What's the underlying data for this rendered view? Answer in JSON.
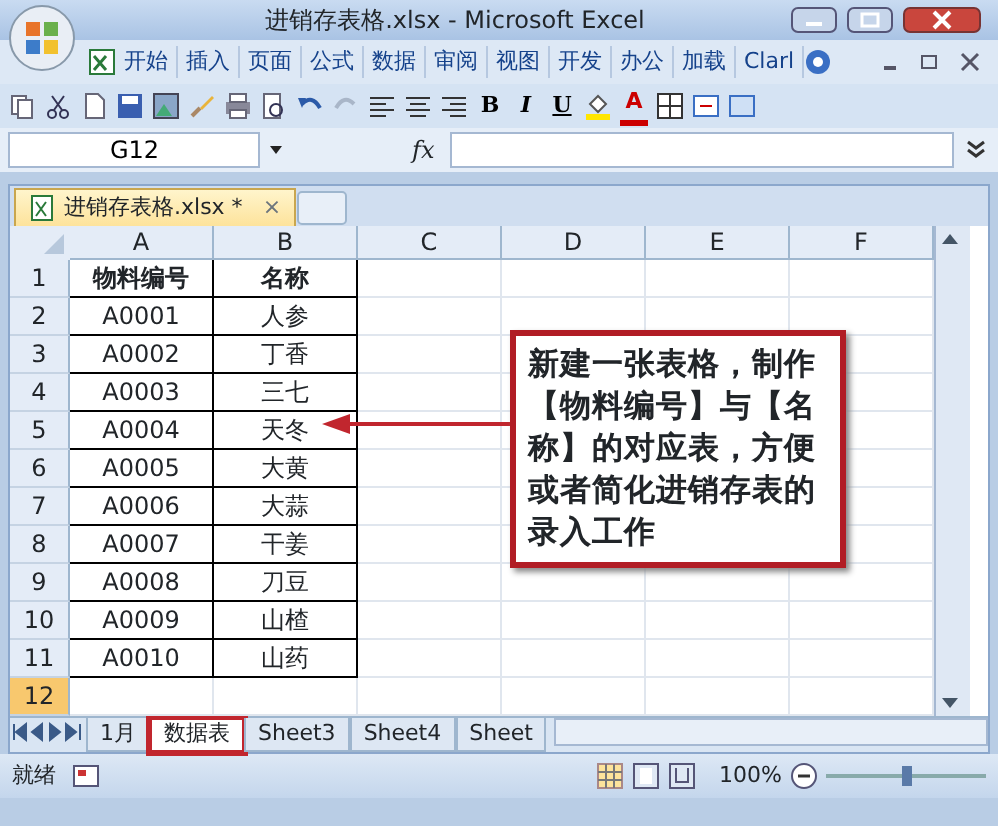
{
  "window": {
    "title": "进销存表格.xlsx - Microsoft Excel"
  },
  "ribbon_tabs": [
    "开始",
    "插入",
    "页面",
    "公式",
    "数据",
    "审阅",
    "视图",
    "开发",
    "办公",
    "加载",
    "Clarl"
  ],
  "format_buttons": [
    "B",
    "I",
    "U",
    "A"
  ],
  "name_box": {
    "value": "G12"
  },
  "formula_bar": {
    "label": "fx"
  },
  "workbook_tab": {
    "label": "进销存表格.xlsx *",
    "close": "×"
  },
  "columns": [
    "A",
    "B",
    "C",
    "D",
    "E",
    "F"
  ],
  "rows": [
    {
      "number": "1",
      "selected": false,
      "cells": [
        "物料编号",
        "名称"
      ]
    },
    {
      "number": "2",
      "selected": false,
      "cells": [
        "A0001",
        "人参"
      ]
    },
    {
      "number": "3",
      "selected": false,
      "cells": [
        "A0002",
        "丁香"
      ]
    },
    {
      "number": "4",
      "selected": false,
      "cells": [
        "A0003",
        "三七"
      ]
    },
    {
      "number": "5",
      "selected": false,
      "cells": [
        "A0004",
        "天冬"
      ]
    },
    {
      "number": "6",
      "selected": false,
      "cells": [
        "A0005",
        "大黄"
      ]
    },
    {
      "number": "7",
      "selected": false,
      "cells": [
        "A0006",
        "大蒜"
      ]
    },
    {
      "number": "8",
      "selected": false,
      "cells": [
        "A0007",
        "干姜"
      ]
    },
    {
      "number": "9",
      "selected": false,
      "cells": [
        "A0008",
        "刀豆"
      ]
    },
    {
      "number": "10",
      "selected": false,
      "cells": [
        "A0009",
        "山楂"
      ]
    },
    {
      "number": "11",
      "selected": false,
      "cells": [
        "A0010",
        "山药"
      ]
    },
    {
      "number": "12",
      "selected": true,
      "cells": []
    }
  ],
  "callout": {
    "text": "新建一张表格，制作【物料编号】与【名称】的对应表，方便或者简化进销存表的录入工作"
  },
  "sheet_tabs": [
    {
      "label": "1月",
      "selected": false,
      "annotated": false
    },
    {
      "label": "数据表",
      "selected": true,
      "annotated": true
    },
    {
      "label": "Sheet3",
      "selected": false,
      "annotated": false
    },
    {
      "label": "Sheet4",
      "selected": false,
      "annotated": false
    },
    {
      "label": "Sheet",
      "selected": false,
      "annotated": false
    }
  ],
  "status_bar": {
    "status": "就绪",
    "zoom": "100%",
    "zoom_slider": {
      "level": 0.5
    }
  }
}
